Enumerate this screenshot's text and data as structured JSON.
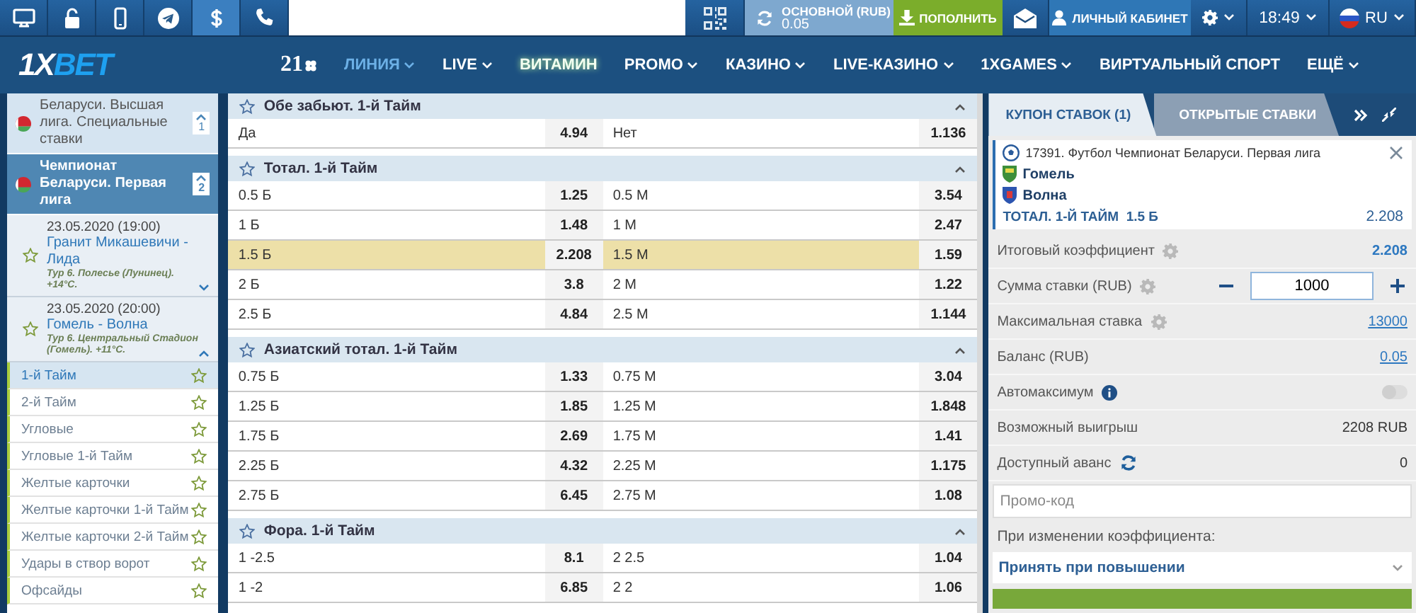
{
  "top_bar": {
    "icons": [
      {
        "kind": "desktop",
        "selected": false
      },
      {
        "kind": "unlock",
        "selected": false
      },
      {
        "kind": "mobile",
        "selected": false
      },
      {
        "kind": "telegram",
        "selected": false
      },
      {
        "kind": "dollar",
        "selected": true
      },
      {
        "kind": "phone",
        "selected": false
      }
    ],
    "balance": {
      "label": "ОСНОВНОЙ (RUB)",
      "value": "0.05"
    },
    "deposit_button": "ПОПОЛНИТЬ",
    "account_button": "ЛИЧНЫЙ КАБИНЕТ",
    "time": "18:49",
    "language": "RU"
  },
  "nav": {
    "logo": {
      "prefix": "1X",
      "suffix": "BET"
    },
    "badge": "21",
    "items": [
      {
        "label": "ЛИНИЯ",
        "selected": true,
        "dropdown": true,
        "highlighted": false
      },
      {
        "label": "LIVE",
        "selected": false,
        "dropdown": true,
        "highlighted": false
      },
      {
        "label": "ВИТАМИН",
        "selected": false,
        "dropdown": false,
        "highlighted": true
      },
      {
        "label": "PROMO",
        "selected": false,
        "dropdown": true,
        "highlighted": false
      },
      {
        "label": "КАЗИНО",
        "selected": false,
        "dropdown": true,
        "highlighted": false
      },
      {
        "label": "LIVE-КАЗИНО",
        "selected": false,
        "dropdown": true,
        "highlighted": false
      },
      {
        "label": "1XGAMES",
        "selected": false,
        "dropdown": true,
        "highlighted": false
      },
      {
        "label": "ВИРТУАЛЬНЫЙ СПОРТ",
        "selected": false,
        "dropdown": false,
        "highlighted": false
      },
      {
        "label": "ЕЩЁ",
        "selected": false,
        "dropdown": true,
        "highlighted": false
      }
    ]
  },
  "sidebar": {
    "leagues": [
      {
        "name": "Беларуси. Высшая лига. Специальные ставки",
        "count": "1",
        "selected": false
      },
      {
        "name": "Чемпионат Беларуси. Первая лига",
        "count": "2",
        "selected": true
      }
    ],
    "matches": [
      {
        "datetime": "23.05.2020 (19:00)",
        "teams": "Гранит Микашевичи - Лида",
        "info": "Тур 6. Полесье (Лунинец). +14°C.",
        "expanded": false
      },
      {
        "datetime": "23.05.2020 (20:00)",
        "teams": "Гомель - Волна",
        "info": "Тур 6. Центральный Стадион (Гомель). +11°C.",
        "expanded": true
      }
    ],
    "markets": [
      {
        "name": "1-й Тайм",
        "selected": true
      },
      {
        "name": "2-й Тайм",
        "selected": false
      },
      {
        "name": "Угловые",
        "selected": false
      },
      {
        "name": "Угловые 1-й Тайм",
        "selected": false
      },
      {
        "name": "Желтые карточки",
        "selected": false
      },
      {
        "name": "Желтые карточки 1-й Тайм",
        "selected": false
      },
      {
        "name": "Желтые карточки 2-й Тайм",
        "selected": false
      },
      {
        "name": "Удары в створ ворот",
        "selected": false
      },
      {
        "name": "Офсайды",
        "selected": false
      }
    ]
  },
  "markets": [
    {
      "title": "Обе забьют. 1-й Тайм",
      "rows": [
        {
          "left": "Да",
          "left_odds": "4.94",
          "right": "Нет",
          "right_odds": "1.136",
          "selected": false
        }
      ]
    },
    {
      "title": "Тотал. 1-й Тайм",
      "rows": [
        {
          "left": "0.5 Б",
          "left_odds": "1.25",
          "right": "0.5 М",
          "right_odds": "3.54",
          "selected": false
        },
        {
          "left": "1 Б",
          "left_odds": "1.48",
          "right": "1 М",
          "right_odds": "2.47",
          "selected": false
        },
        {
          "left": "1.5 Б",
          "left_odds": "2.208",
          "right": "1.5 М",
          "right_odds": "1.59",
          "selected": true
        },
        {
          "left": "2 Б",
          "left_odds": "3.8",
          "right": "2 М",
          "right_odds": "1.22",
          "selected": false
        },
        {
          "left": "2.5 Б",
          "left_odds": "4.84",
          "right": "2.5 М",
          "right_odds": "1.144",
          "selected": false
        }
      ]
    },
    {
      "title": "Азиатский тотал. 1-й Тайм",
      "rows": [
        {
          "left": "0.75 Б",
          "left_odds": "1.33",
          "right": "0.75 М",
          "right_odds": "3.04",
          "selected": false
        },
        {
          "left": "1.25 Б",
          "left_odds": "1.85",
          "right": "1.25 М",
          "right_odds": "1.848",
          "selected": false
        },
        {
          "left": "1.75 Б",
          "left_odds": "2.69",
          "right": "1.75 М",
          "right_odds": "1.41",
          "selected": false
        },
        {
          "left": "2.25 Б",
          "left_odds": "4.32",
          "right": "2.25 М",
          "right_odds": "1.175",
          "selected": false
        },
        {
          "left": "2.75 Б",
          "left_odds": "6.45",
          "right": "2.75 М",
          "right_odds": "1.08",
          "selected": false
        }
      ]
    },
    {
      "title": "Фора. 1-й Тайм",
      "rows": [
        {
          "left": "1 -2.5",
          "left_odds": "8.1",
          "right": "2 2.5",
          "right_odds": "1.04",
          "selected": false
        },
        {
          "left": "1 -2",
          "left_odds": "6.85",
          "right": "2 2",
          "right_odds": "1.06",
          "selected": false
        }
      ]
    }
  ],
  "coupon": {
    "tabs": [
      {
        "label": "КУПОН СТАВОК (1)",
        "selected": true
      },
      {
        "label": "ОТКРЫТЫЕ СТАВКИ",
        "selected": false
      }
    ],
    "bet": {
      "event": "17391. Футбол Чемпионат Беларуси. Первая лига",
      "home": "Гомель",
      "away": "Волна",
      "market": "ТОТАЛ. 1-Й ТАЙМ  1.5 Б",
      "odds": "2.208"
    },
    "rows": [
      {
        "kind": "total",
        "label": "Итоговый коэффициент",
        "settings": true,
        "value": "2.208"
      },
      {
        "kind": "stake",
        "label": "Сумма ставки (RUB)",
        "settings": true,
        "value": "1000"
      },
      {
        "kind": "link",
        "label": "Максимальная ставка",
        "settings": true,
        "value": "13000"
      },
      {
        "kind": "link",
        "label": "Баланс (RUB)",
        "settings": false,
        "value": "0.05"
      },
      {
        "kind": "toggle",
        "label": "Автомаксимум",
        "on": false
      },
      {
        "kind": "plain",
        "label": "Возможный выигрыш",
        "value": "2208 RUB"
      },
      {
        "kind": "refresh",
        "label": "Доступный аванс",
        "value": "0"
      }
    ],
    "promo": {
      "placeholder": "Промо-код"
    },
    "odds_change": {
      "label": "При изменении коэффициента:",
      "value": "Принять при повышении"
    }
  }
}
